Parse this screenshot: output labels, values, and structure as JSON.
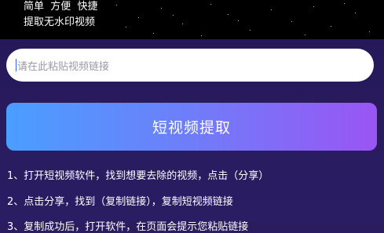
{
  "header": {
    "tagline_features": "简单  方便  快捷",
    "tagline_sub": "提取无水印视频"
  },
  "input": {
    "placeholder": "请在此粘贴视频链接"
  },
  "extract_button": {
    "label": "短视频提取"
  },
  "instructions": [
    "1、打开短视频软件，找到想要去除的视频，点击（分享）",
    "2、点击分享，找到（复制链接），复制短视频链接",
    "3、复制成功后，打开软件，在页面会提示您粘贴链接"
  ],
  "colors": {
    "accent_start": "#4a9eff",
    "accent_end": "#9a55f3",
    "background": "#2a1c5e"
  }
}
